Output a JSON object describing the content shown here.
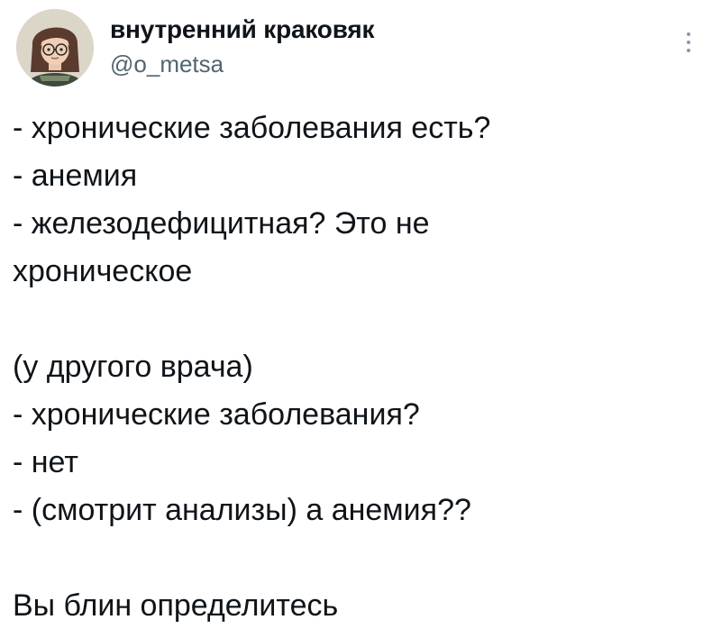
{
  "author": {
    "display_name": "внутренний краковяк",
    "handle": "@o_metsa",
    "avatar_icon": "avatar-illustration"
  },
  "more_icon": "more-vertical-icon",
  "tweet": {
    "lines": [
      "- хронические заболевания есть?",
      "- анемия",
      "- железодефицитная? Это не",
      "хроническое",
      "",
      "(у другого врача)",
      "- хронические заболевания?",
      "- нет",
      "- (смотрит анализы) а анемия??",
      "",
      "Вы блин определитесь"
    ]
  },
  "colors": {
    "text": "#0f1419",
    "secondary": "#536471",
    "background": "#ffffff"
  }
}
